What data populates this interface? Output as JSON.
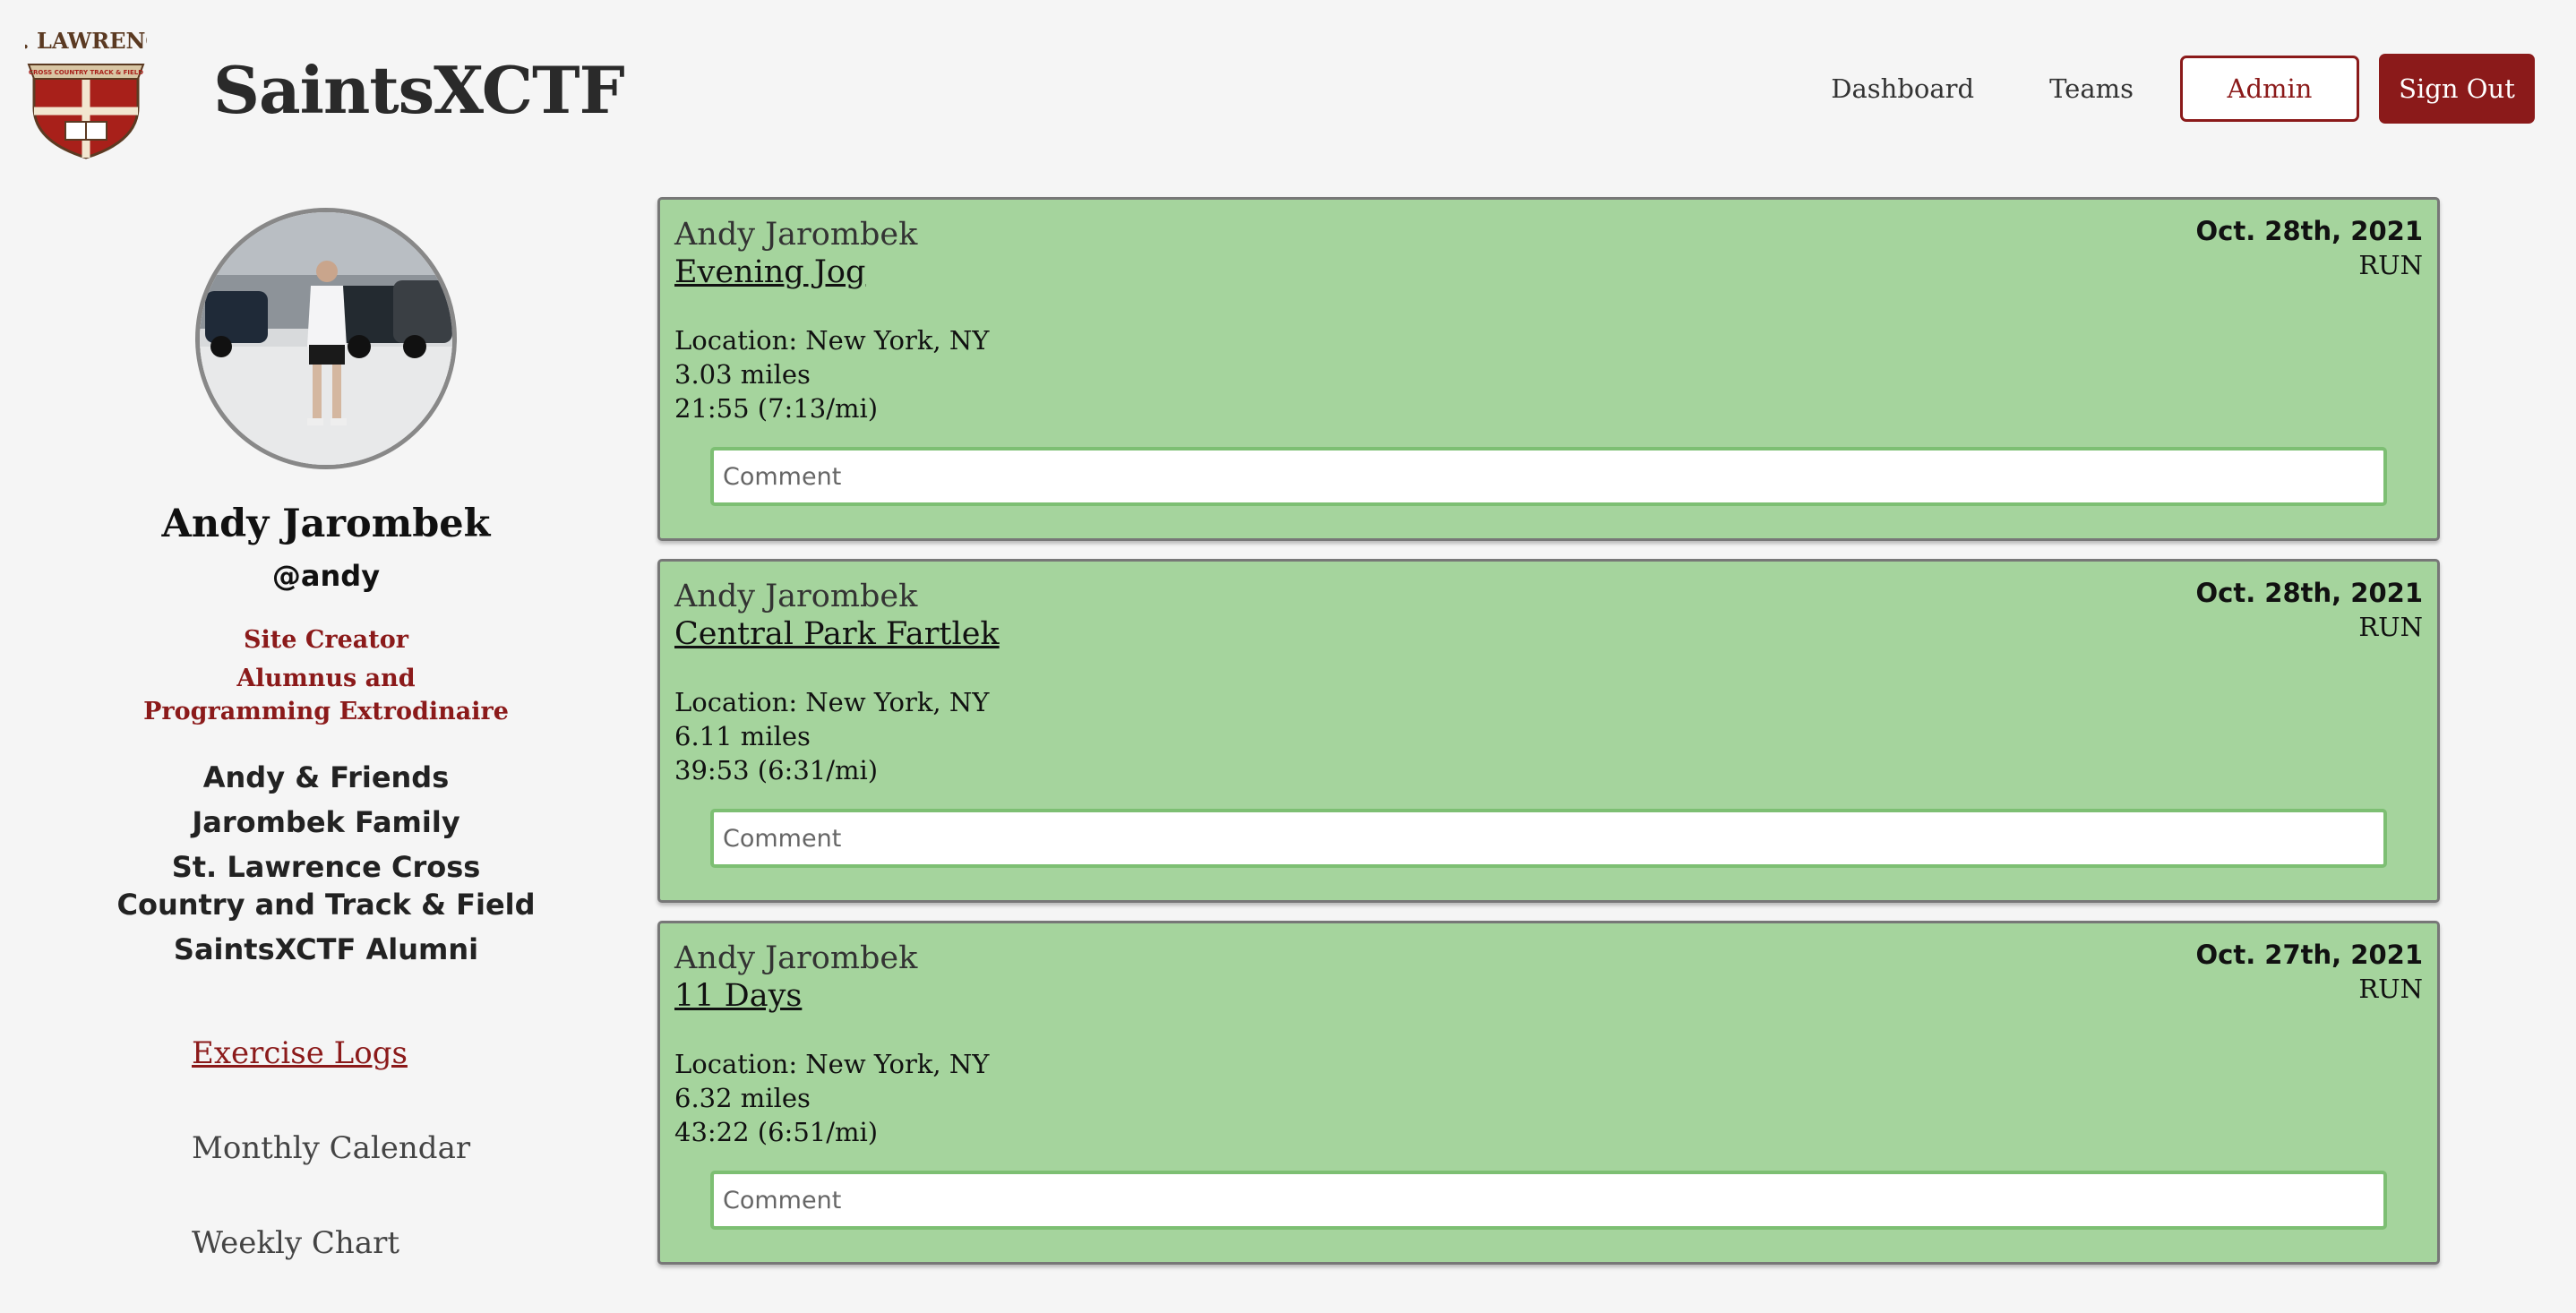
{
  "header": {
    "logo_text": "ST. LAWRENCE",
    "logo_subtext": "CROSS COUNTRY TRACK & FIELD",
    "brand": "SaintsXCTF",
    "nav": [
      {
        "label": "Dashboard"
      },
      {
        "label": "Teams"
      },
      {
        "label": "Admin"
      },
      {
        "label": "Sign Out"
      }
    ]
  },
  "profile": {
    "name": "Andy Jarombek",
    "username": "@andy",
    "flair": [
      "Site Creator",
      "Alumnus and Programming Extrodinaire"
    ],
    "groups": [
      "Andy & Friends",
      "Jarombek Family",
      "St. Lawrence Cross Country and Track & Field",
      "SaintsXCTF Alumni"
    ],
    "nav": [
      {
        "label": "Exercise Logs",
        "active": true
      },
      {
        "label": "Monthly Calendar",
        "active": false
      },
      {
        "label": "Weekly Chart",
        "active": false
      }
    ]
  },
  "logs": [
    {
      "user": "Andy Jarombek",
      "title": "Evening Jog",
      "date": "Oct. 28th, 2021",
      "type": "RUN",
      "location": "Location: New York, NY",
      "distance": "3.03 miles",
      "time": "21:55 (7:13/mi)",
      "comment_placeholder": "Comment"
    },
    {
      "user": "Andy Jarombek",
      "title": "Central Park Fartlek",
      "date": "Oct. 28th, 2021",
      "type": "RUN",
      "location": "Location: New York, NY",
      "distance": "6.11 miles",
      "time": "39:53 (6:31/mi)",
      "comment_placeholder": "Comment"
    },
    {
      "user": "Andy Jarombek",
      "title": "11 Days",
      "date": "Oct. 27th, 2021",
      "type": "RUN",
      "location": "Location: New York, NY",
      "distance": "6.32 miles",
      "time": "43:22 (6:51/mi)",
      "comment_placeholder": "Comment"
    }
  ],
  "colors": {
    "brand_red": "#8b1a1a",
    "card_green": "#a5d49d",
    "comment_border": "#7dbf73",
    "background": "#f5f5f5"
  }
}
